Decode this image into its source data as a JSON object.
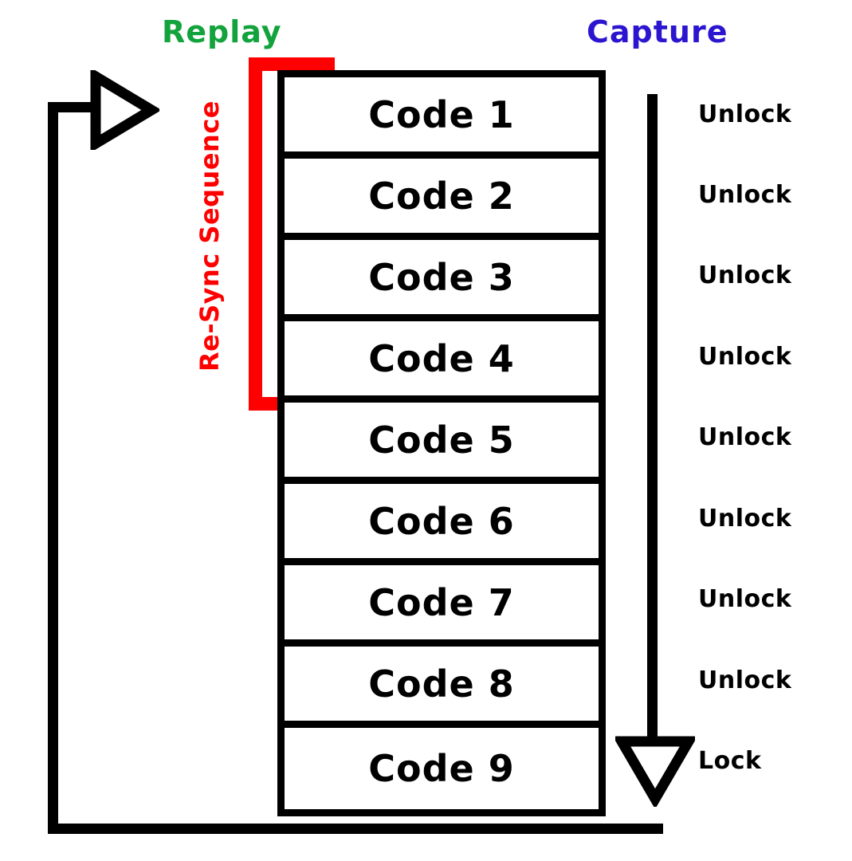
{
  "diagram": {
    "title_labels": {
      "replay": "Replay",
      "capture": "Capture",
      "resync": "Re-Sync Sequence"
    },
    "colors": {
      "replay": "#12a33c",
      "capture": "#2b15cf",
      "resync": "#ff0000",
      "stroke": "#000000",
      "background": "#ffffff"
    },
    "codes": [
      {
        "label": "Code 1",
        "status": "Unlock"
      },
      {
        "label": "Code 2",
        "status": "Unlock"
      },
      {
        "label": "Code 3",
        "status": "Unlock"
      },
      {
        "label": "Code 4",
        "status": "Unlock"
      },
      {
        "label": "Code 5",
        "status": "Unlock"
      },
      {
        "label": "Code 6",
        "status": "Unlock"
      },
      {
        "label": "Code 7",
        "status": "Unlock"
      },
      {
        "label": "Code 8",
        "status": "Unlock"
      },
      {
        "label": "Code 9",
        "status": "Lock"
      }
    ],
    "resync_span": {
      "from_code": "Code 1",
      "to_code": "Code 4"
    },
    "icons": {
      "replay_arrow": "triangle-right-arrow-icon",
      "lock_arrow": "triangle-down-arrow-icon"
    }
  }
}
